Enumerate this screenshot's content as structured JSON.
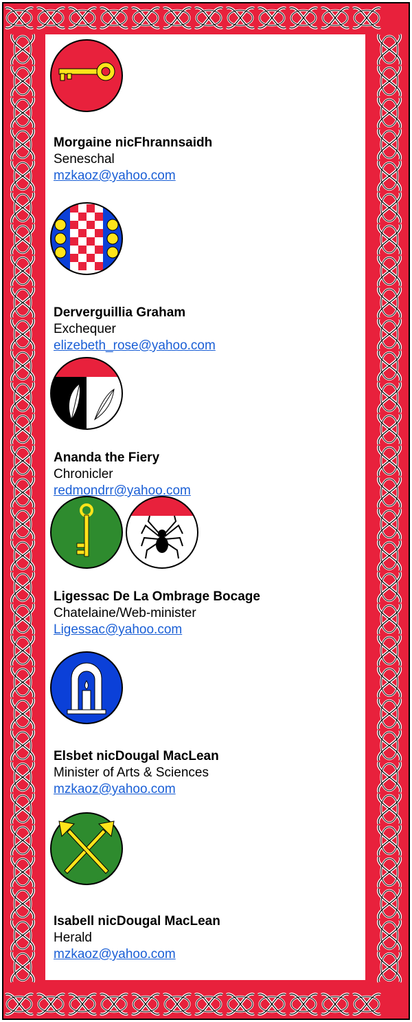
{
  "officers": [
    {
      "name": "Morgaine nicFhrannsaidh",
      "office": "Seneschal",
      "email": "mzkaoz@yahoo.com",
      "device": "key-on-red-icon"
    },
    {
      "name": "Derverguillia Graham",
      "office": "Exchequer",
      "email": "elizebeth_rose@yahoo.com",
      "device": "checky-with-bezants-icon"
    },
    {
      "name": "Ananda the Fiery",
      "office": "Chronicler",
      "email": "redmondrr@yahoo.com",
      "device": "quills-icon"
    },
    {
      "name": "Ligessac De La Ombrage Bocage",
      "office": "Chatelaine/Web-minister",
      "email": "Ligessac@yahoo.com",
      "device": "key-and-spider-icon"
    },
    {
      "name": "Elsbet nicDougal MacLean",
      "office": "Minister of Arts & Sciences",
      "email": "mzkaoz@yahoo.com",
      "device": "candle-arch-icon"
    },
    {
      "name": "Isabell nicDougal MacLean",
      "office": "Herald",
      "email": "mzkaoz@yahoo.com",
      "device": "crossed-trumpets-icon"
    }
  ],
  "colors": {
    "border": "#e8213c",
    "link": "#1a5fd6",
    "green": "#2e8b2e",
    "blue": "#0b40d8",
    "gold": "#ffe41a"
  }
}
